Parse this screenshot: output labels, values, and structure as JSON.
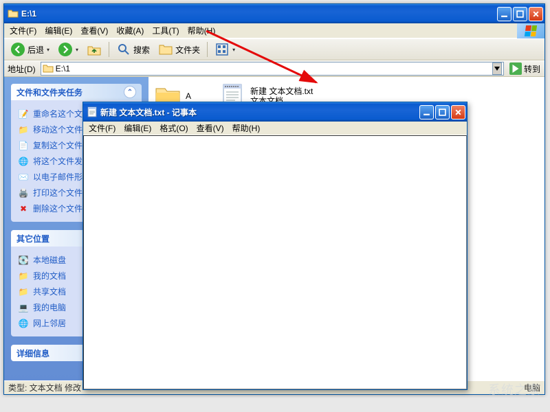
{
  "explorer": {
    "title": "E:\\1",
    "menus": [
      "文件(F)",
      "编辑(E)",
      "查看(V)",
      "收藏(A)",
      "工具(T)",
      "帮助(H)"
    ],
    "toolbar": {
      "back": "后退",
      "search": "搜索",
      "folders": "文件夹"
    },
    "addressbar": {
      "label": "地址(D)",
      "value": "E:\\1",
      "go": "转到"
    },
    "sidebar": {
      "panel1": {
        "title": "文件和文件夹任务",
        "tasks": [
          "重命名这个文件",
          "移动这个文件",
          "复制这个文件",
          "将这个文件发布到 Web",
          "以电子邮件形式发送此文件",
          "打印这个文件",
          "删除这个文件"
        ]
      },
      "panel2": {
        "title": "其它位置",
        "tasks": [
          "本地磁盘",
          "我的文档",
          "共享文档",
          "我的电脑",
          "网上邻居"
        ]
      },
      "panel3": {
        "title": "详细信息"
      }
    },
    "files": {
      "folderA": "A",
      "txtfile_line1": "新建 文本文档.txt",
      "txtfile_line2": "文本文档"
    },
    "status": "类型: 文本文档 修改",
    "status_right": "电脑"
  },
  "notepad": {
    "title": "新建 文本文档.txt - 记事本",
    "menus": [
      "文件(F)",
      "编辑(E)",
      "格式(O)",
      "查看(V)",
      "帮助(H)"
    ],
    "content": ""
  }
}
